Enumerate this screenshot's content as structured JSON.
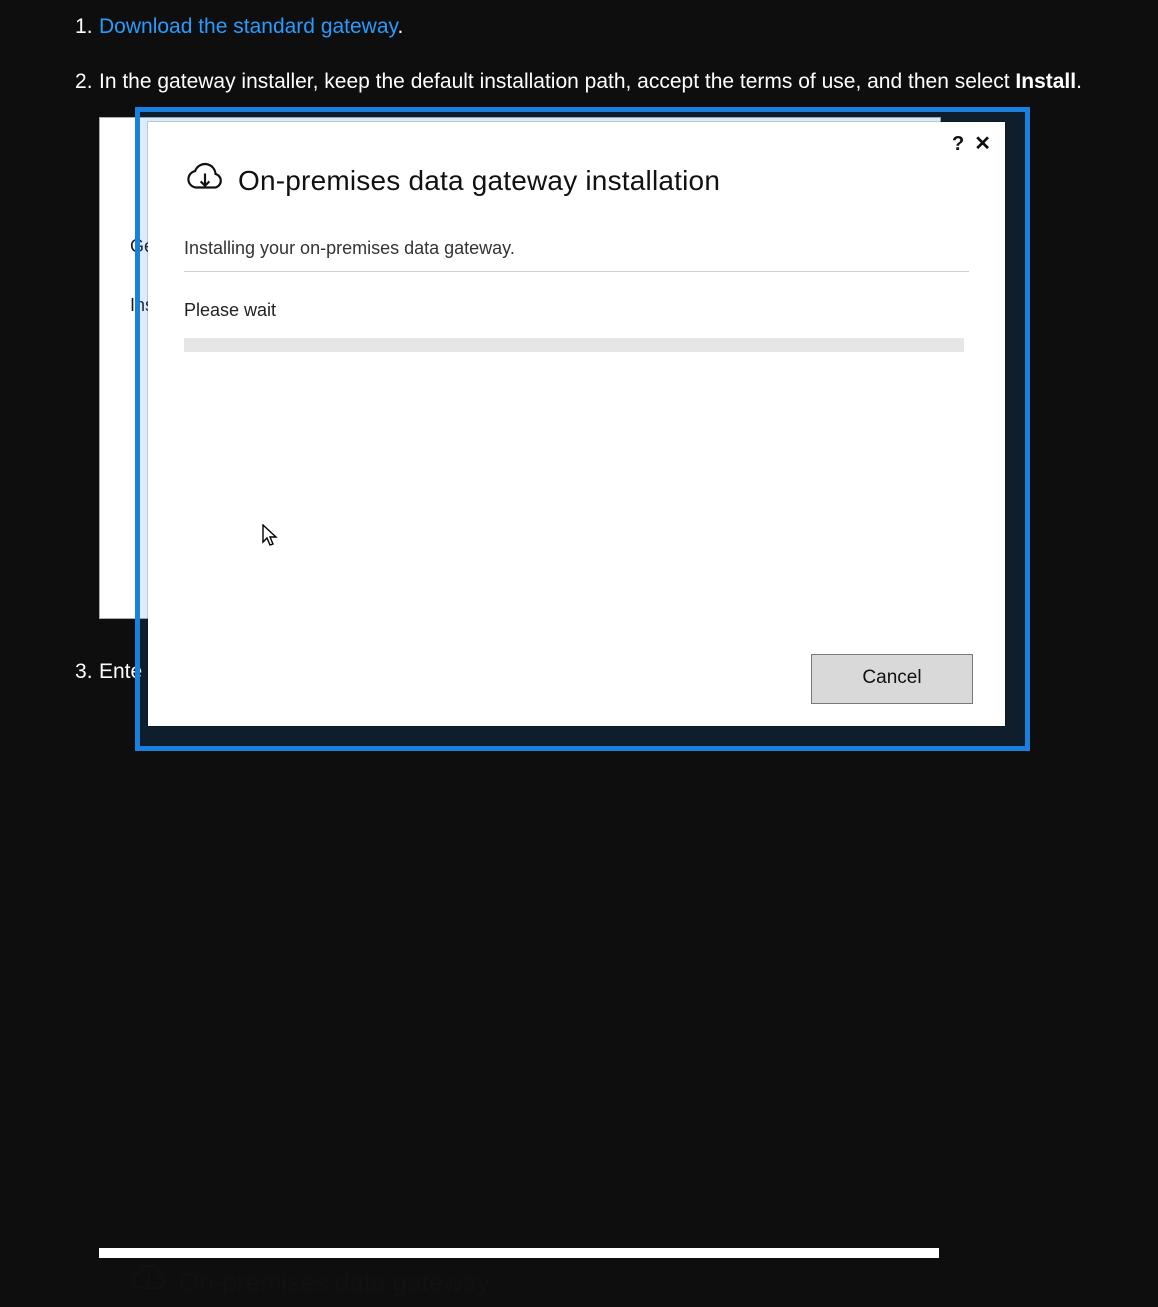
{
  "steps": {
    "one": {
      "link_text": "Download the standard gateway",
      "suffix": "."
    },
    "two": {
      "prefix": "In the gateway installer, keep the default installation path, accept the terms of use, and then select ",
      "bold": "Install",
      "suffix": "."
    },
    "three": {
      "visible_text": "Ente"
    }
  },
  "dialog": {
    "title": "On-premises data gateway installation",
    "installing_text": "Installing your on-premises data gateway.",
    "please_wait": "Please wait",
    "help_icon_char": "?",
    "close_icon_char": "✕",
    "cancel_label": "Cancel"
  },
  "hidden_behind": {
    "row1": "Ge",
    "row2": "Ins"
  },
  "second_preview": {
    "title": "On-premises data gateway"
  }
}
